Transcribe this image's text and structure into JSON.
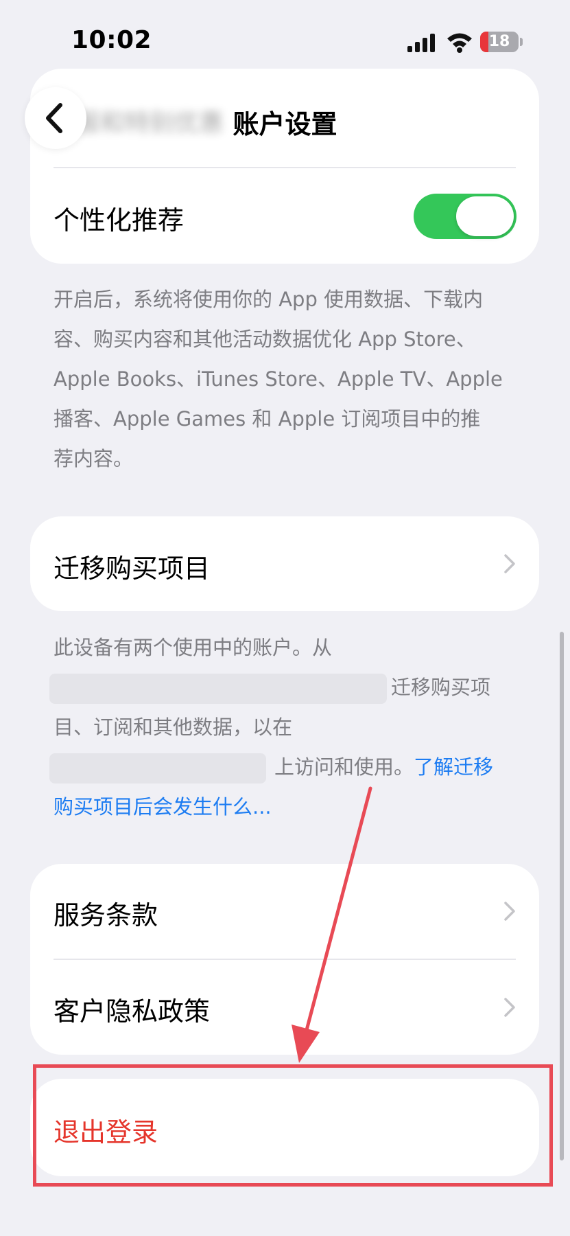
{
  "status_bar": {
    "time": "10:02",
    "battery": "18",
    "signal_icon": "signal-bars-icon",
    "wifi_icon": "wifi-icon"
  },
  "nav": {
    "title": "账户设置",
    "back_icon": "chevron-left-icon"
  },
  "section_top": {
    "partial_label": "报和特别优惠",
    "personalized_label": "个性化推荐",
    "toggle_on": true,
    "footnote": [
      "开启后，系统将使用你的 App 使用数据、下载内",
      "容、购买内容和其他活动数据优化 App Store、",
      "Apple Books、iTunes Store、Apple TV、Apple",
      "播客、Apple Games 和 Apple 订阅项目中的推",
      "荐内容。"
    ]
  },
  "section_migrate": {
    "label": "迁移购买项目",
    "footnote": {
      "line1": "此设备有两个使用中的账户。从",
      "line2_suffix": "迁移购买项",
      "line3": "目、订阅和其他数据，以在",
      "line4_mid": "上访问和使用。",
      "link_part1": "了解迁移",
      "link_part2": "购买项目后会发生什么..."
    }
  },
  "section_legal": {
    "terms": "服务条款",
    "privacy": "客户隐私政策"
  },
  "section_signout": {
    "label": "退出登录"
  },
  "colors": {
    "background": "#f0f0f5",
    "toggle_on": "#34c759",
    "link": "#1c7cf2",
    "destructive": "#e5352b",
    "annotation": "#e84a55"
  }
}
